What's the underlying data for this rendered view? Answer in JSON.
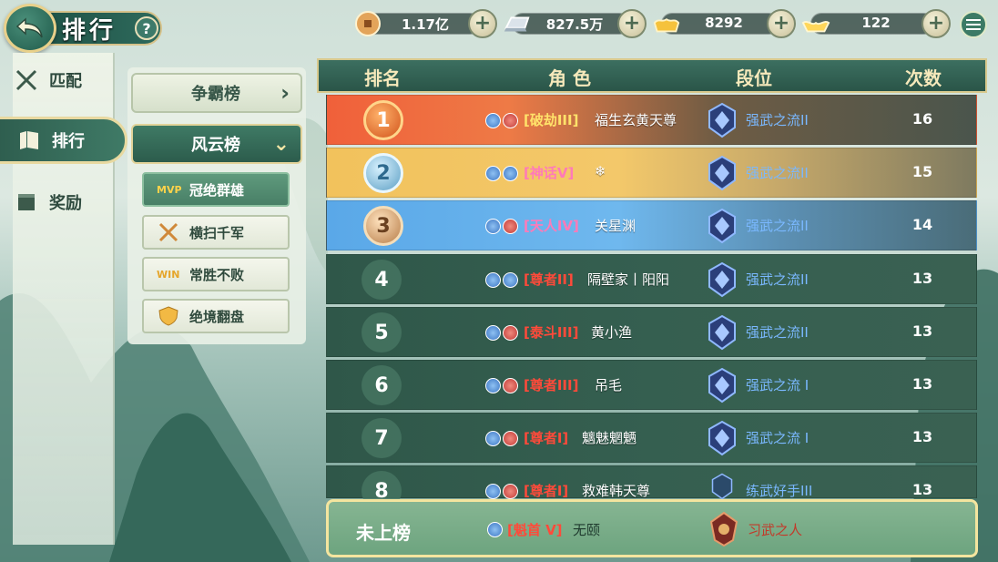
{
  "header": {
    "title": "排行",
    "help": "?",
    "resources": [
      {
        "name": "copper-coin",
        "value": "1.17亿"
      },
      {
        "name": "silver-ingot",
        "value": "827.5万"
      },
      {
        "name": "gold-ingot",
        "value": "8292"
      },
      {
        "name": "yuanbao",
        "value": "122"
      }
    ]
  },
  "nav": {
    "items": [
      {
        "label": "匹配",
        "icon": "crossed-swords-icon"
      },
      {
        "label": "排行",
        "icon": "scroll-icon"
      },
      {
        "label": "奖励",
        "icon": "treasure-icon"
      }
    ],
    "active": "排行"
  },
  "subnav": {
    "groups": [
      {
        "label": "争霸榜",
        "arrow": "›"
      },
      {
        "label": "风云榜",
        "arrow": "⌄"
      }
    ],
    "items": [
      {
        "label": "冠绝群雄",
        "badge": "MVP"
      },
      {
        "label": "横扫千军",
        "badge": ""
      },
      {
        "label": "常胜不败",
        "badge": "WIN"
      },
      {
        "label": "绝境翻盘",
        "badge": ""
      }
    ]
  },
  "table": {
    "headers": [
      "排名",
      "角 色",
      "段位",
      "次数"
    ],
    "rows": [
      {
        "rank": "1",
        "tier": "[破劫III]",
        "name": "福生玄黄天尊",
        "segment": "强武之流II",
        "count": "16"
      },
      {
        "rank": "2",
        "tier": "[神话V]",
        "name": "❄",
        "segment": "强武之流II",
        "count": "15"
      },
      {
        "rank": "3",
        "tier": "[天人IV]",
        "name": "关星渊",
        "segment": "强武之流II",
        "count": "14"
      },
      {
        "rank": "4",
        "tier": "[尊者II]",
        "name": "隔壁家丨阳阳",
        "segment": "强武之流II",
        "count": "13"
      },
      {
        "rank": "5",
        "tier": "[泰斗III]",
        "name": "黄小渔",
        "segment": "强武之流II",
        "count": "13"
      },
      {
        "rank": "6",
        "tier": "[尊者III]",
        "name": "吊毛",
        "segment": "强武之流 I",
        "count": "13"
      },
      {
        "rank": "7",
        "tier": "[尊者I]",
        "name": "魑魅魍魉",
        "segment": "强武之流 I",
        "count": "13"
      },
      {
        "rank": "8",
        "tier": "[尊者I]",
        "name": "救难韩天尊",
        "segment": "练武好手III",
        "count": "13"
      }
    ],
    "mine": {
      "rank": "未上榜",
      "tier": "[魁首 V]",
      "name": "无颐",
      "segment": "习武之人"
    }
  },
  "colors": {
    "tier_gold": "#ffd24a",
    "tier_pink": "#ff7ab8",
    "tier_red": "#ff4a3a",
    "segment_blue": "#7ab8ff",
    "segment_red": "#c23a2a"
  }
}
